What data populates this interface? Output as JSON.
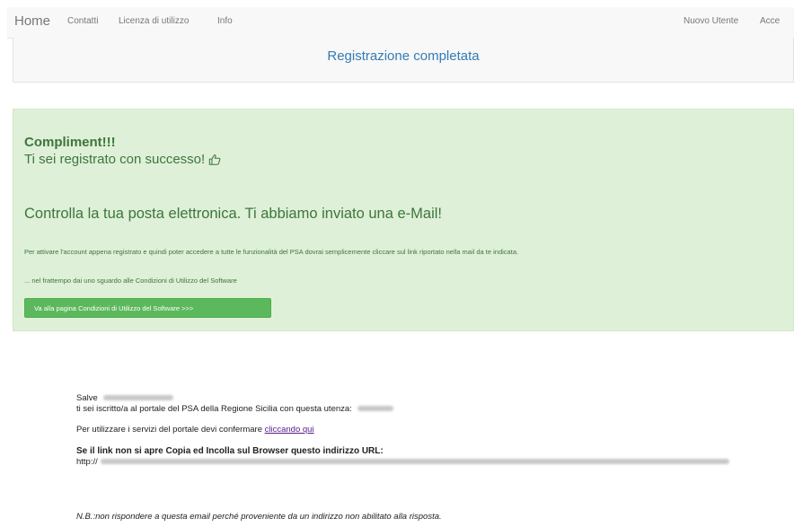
{
  "navbar": {
    "brand": "Home",
    "links": [
      "Contatti",
      "Licenza di utilizzo",
      "Info"
    ],
    "right_links": [
      "Nuovo Utente",
      "Acce"
    ]
  },
  "page_title": "Registrazione completata",
  "alert": {
    "strong": "Compliment!!!",
    "sub": "Ti sei registrato con successo!",
    "heading": "Controlla la tua posta elettronica. Ti abbiamo inviato una e-Mail!",
    "instructions": "Per attivare l'account appena registrato e quindi poter accedere a tutte le funzionalità del PSA dovrai semplicemente cliccare sul link riportato nella mail da te indicata.",
    "note": "... nel frattempo dai uno sguardo alle Condizioni di Utilizzo del Software",
    "button_label": "Va alla pagina Condizioni di Utilizzo del Software >>>",
    "colors": {
      "background": "#dff0d8",
      "text": "#3c763d",
      "button": "#5cb85c"
    },
    "icon": "thumbs-up-icon"
  },
  "email": {
    "greeting": "Salve",
    "registered_line": "ti sei iscritto/a al portale del PSA della Regione Sicilia con questa utenza:",
    "confirm_prefix": "Per utilizzare i servizi del portale devi confermare",
    "confirm_link": "cliccando qui",
    "copy_instruction": "Se il link non si apre Copia ed Incolla sul Browser questo indirizzo URL:",
    "url_prefix": "http://",
    "footer_note": "N.B.:non rispondere a questa email perché proveniente da un indirizzo non abilitato alla risposta."
  }
}
